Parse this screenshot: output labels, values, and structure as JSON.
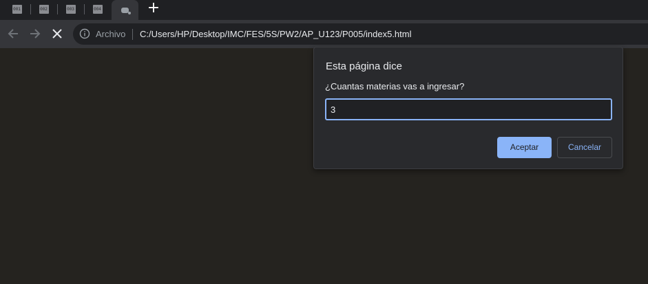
{
  "browser": {
    "tabs": [
      {
        "favicon_text": "001"
      },
      {
        "favicon_text": "002"
      },
      {
        "favicon_text": "003"
      },
      {
        "favicon_text": "004"
      }
    ],
    "new_tab_icon": "plus-icon",
    "back_icon": "arrow-left-icon",
    "forward_icon": "arrow-right-icon",
    "stop_icon": "close-icon",
    "security_label": "Archivo",
    "url": "C:/Users/HP/Desktop/IMC/FES/5S/PW2/AP_U123/P005/index5.html"
  },
  "dialog": {
    "title": "Esta página dice",
    "message": "¿Cuantas materias vas a ingresar?",
    "input_value": "3",
    "accept_label": "Aceptar",
    "cancel_label": "Cancelar"
  },
  "colors": {
    "page_background": "#25231f",
    "accent": "#8ab4f8",
    "dialog_background": "#292a2d"
  }
}
